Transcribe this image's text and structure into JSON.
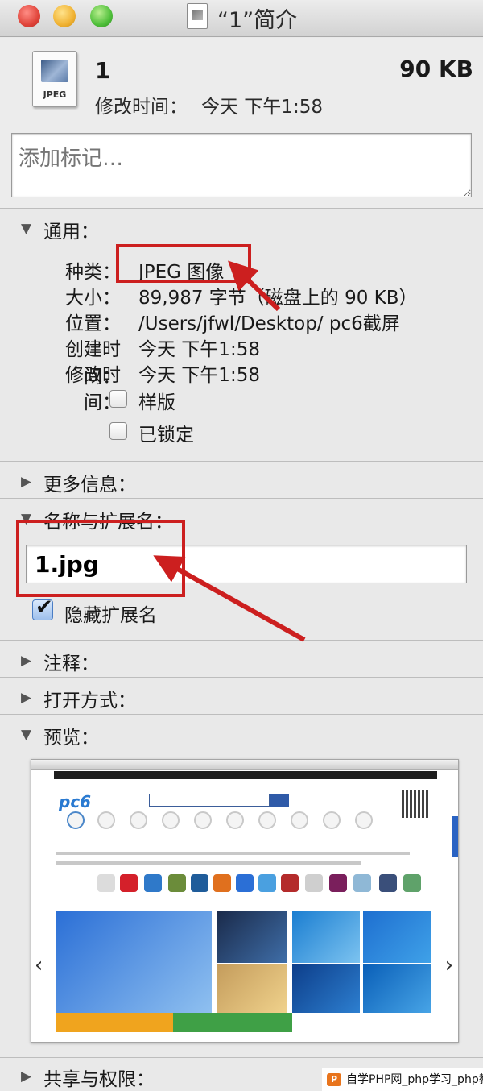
{
  "window": {
    "title": "“1”简介"
  },
  "file": {
    "icon_label": "JPEG",
    "name": "1",
    "size": "90 KB",
    "modified_label": "修改时间：",
    "modified_value": "今天 下午1:58"
  },
  "tags": {
    "placeholder": "添加标记…"
  },
  "general": {
    "header": "通用：",
    "kind_label": "种类：",
    "kind_value": "JPEG 图像",
    "size_label": "大小：",
    "size_value": "89,987 字节（磁盘上的 90 KB）",
    "location_label": "位置：",
    "location_value": "/Users/jfwl/Desktop/ pc6截屏",
    "created_label": "创建时间：",
    "created_value": "今天 下午1:58",
    "modified_label": "修改时间：",
    "modified_value": "今天 下午1:58",
    "stationery_label": "样版",
    "locked_label": "已锁定"
  },
  "more_info": {
    "header": "更多信息："
  },
  "name_ext": {
    "header": "名称与扩展名：",
    "value": "1.jpg",
    "hide_ext_label": "隐藏扩展名",
    "hide_ext_checked": true
  },
  "comments": {
    "header": "注释："
  },
  "open_with": {
    "header": "打开方式："
  },
  "preview": {
    "header": "预览：",
    "logo_text": "pc6"
  },
  "sharing": {
    "header": "共享与权限："
  },
  "watermark": {
    "logo": "P",
    "text": "自学PHP网_php学习_php教"
  },
  "colors": {
    "annotation_red": "#cc1f1f"
  },
  "icons": {
    "expanded": "disclosure-triangle-expanded",
    "collapsed": "disclosure-triangle-collapsed"
  }
}
